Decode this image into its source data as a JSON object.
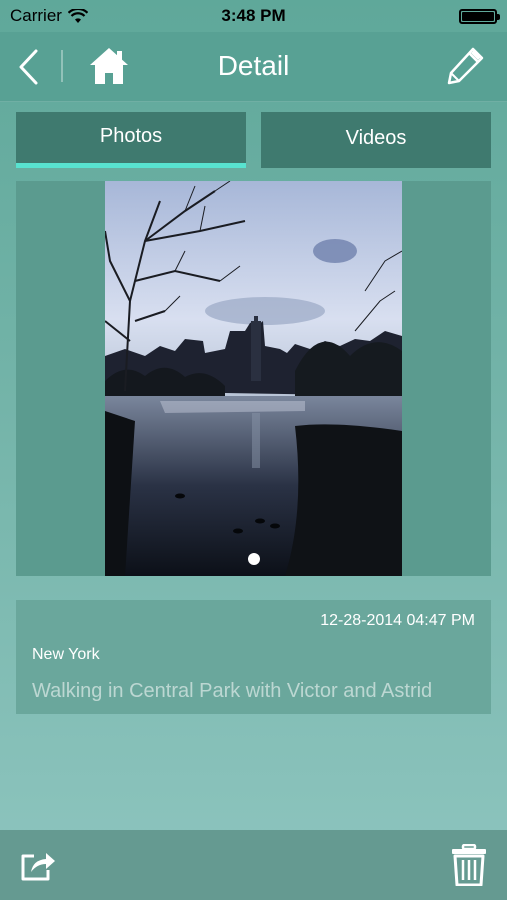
{
  "status_bar": {
    "carrier": "Carrier",
    "time": "3:48 PM"
  },
  "nav": {
    "title": "Detail",
    "icons": [
      "chevron-left-icon",
      "home-icon",
      "pencil-icon"
    ]
  },
  "tabs": [
    {
      "label": "Photos",
      "selected": true
    },
    {
      "label": "Videos",
      "selected": false
    }
  ],
  "photo": {
    "page_count": 1,
    "current_page": 1
  },
  "entry": {
    "date": "12-28-2014 04:47 PM",
    "location": "New York",
    "description": "Walking in Central Park with Victor and Astrid"
  },
  "toolbar": {
    "icons": [
      "share-icon",
      "trash-icon"
    ]
  },
  "colors": {
    "nav_bg": "#58a194",
    "tab_bg": "#3f7a6f",
    "tab_indicator": "#58e3d0"
  }
}
